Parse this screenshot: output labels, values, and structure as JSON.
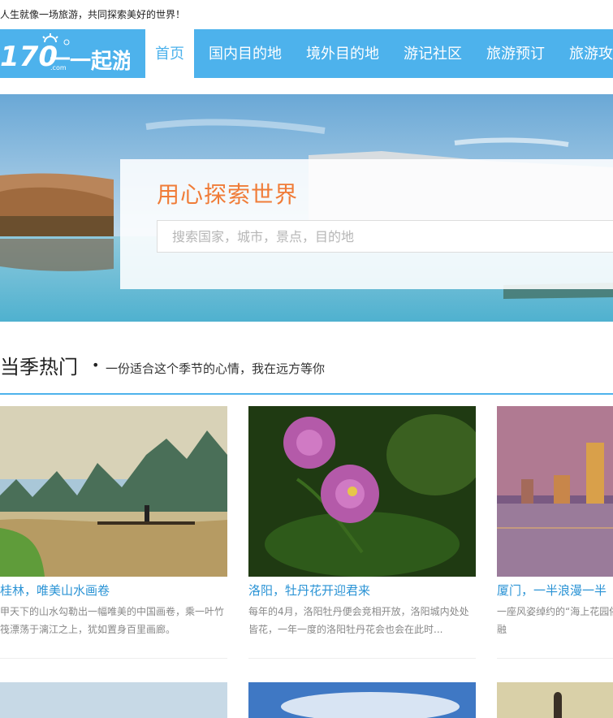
{
  "header": {
    "tagline": "人生就像一场旅游，共同探索美好的世界！",
    "logo_text": "一起游",
    "logo_number": "170",
    "logo_sub": ".com",
    "nav": [
      {
        "label": "首页",
        "active": true
      },
      {
        "label": "国内目的地"
      },
      {
        "label": "境外目的地"
      },
      {
        "label": "游记社区"
      },
      {
        "label": "旅游预订"
      },
      {
        "label": "旅游攻略"
      }
    ]
  },
  "banner": {
    "slogan": "用心探索世界",
    "search_placeholder": "搜索国家，城市，景点，目的地"
  },
  "section": {
    "title": "当季热门",
    "dot": "•",
    "subtitle": "一份适合这个季节的心情，我在远方等你"
  },
  "cards": [
    {
      "title": "桂林，唯美山水画卷",
      "desc": "甲天下的山水勾勒出一幅唯美的中国画卷，乘一叶竹筏漂荡于漓江之上，犹如置身百里画廊。"
    },
    {
      "title": "洛阳，牡丹花开迎君来",
      "desc": "每年的4月，洛阳牡丹便会竞相开放，洛阳城内处处皆花，一年一度的洛阳牡丹花会也会在此时..."
    },
    {
      "title": "厦门，一半浪漫一半",
      "desc": "一座风姿绰约的“海上花园俗、海滨美食、异国建筑融"
    }
  ],
  "colors": {
    "brand": "#4db2ec",
    "accent": "#f07c38",
    "link": "#2a93d5"
  }
}
